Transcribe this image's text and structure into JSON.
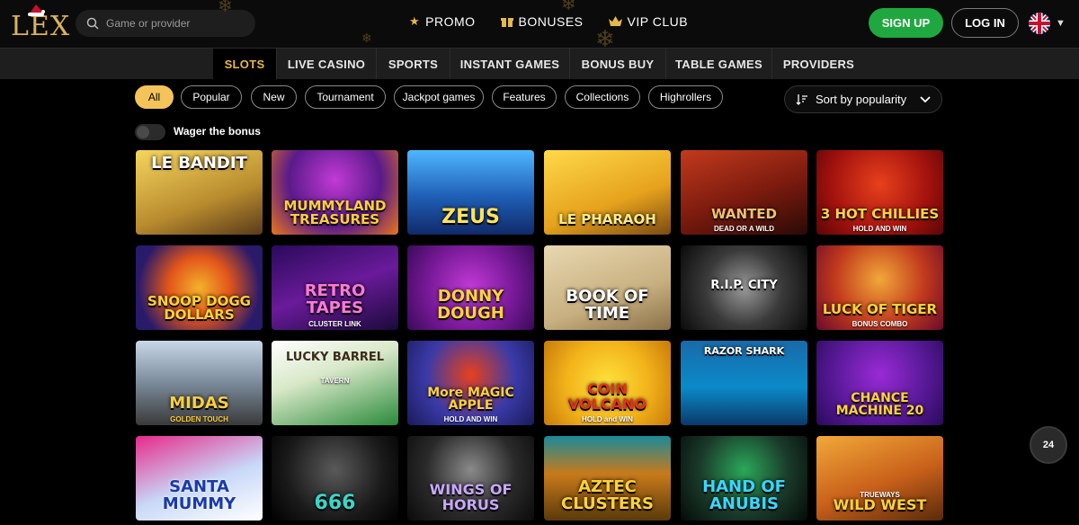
{
  "header": {
    "logo_text": "LEX",
    "search_placeholder": "Game or provider",
    "nav": [
      {
        "label": "PROMO",
        "icon": "star-icon"
      },
      {
        "label": "BONUSES",
        "icon": "gift-icon"
      },
      {
        "label": "VIP CLUB",
        "icon": "crown-icon"
      }
    ],
    "signup_label": "SIGN UP",
    "login_label": "LOG IN",
    "language_icon": "uk-flag-icon"
  },
  "categories": [
    "SLOTS",
    "LIVE CASINO",
    "SPORTS",
    "INSTANT GAMES",
    "BONUS BUY",
    "TABLE GAMES",
    "PROVIDERS"
  ],
  "active_category": "SLOTS",
  "filters": [
    "All",
    "Popular",
    "New",
    "Tournament",
    "Jackpot games",
    "Features",
    "Collections",
    "Highrollers"
  ],
  "active_filter": "All",
  "sort_label": "Sort by popularity",
  "wager_label": "Wager the bonus",
  "games": [
    {
      "title": "LE BANDIT",
      "sub": ""
    },
    {
      "title": "MUMMYLAND TREASURES",
      "sub": ""
    },
    {
      "title": "ZEUS",
      "sub": ""
    },
    {
      "title": "LE PHARAOH",
      "sub": ""
    },
    {
      "title": "WANTED",
      "sub": "DEAD OR A WILD"
    },
    {
      "title": "3 HOT CHILLIES",
      "sub": "HOLD AND WIN"
    },
    {
      "title": "SNOOP DOGG DOLLARS",
      "sub": ""
    },
    {
      "title": "RETRO TAPES",
      "sub": "CLUSTER LINK"
    },
    {
      "title": "DONNY DOUGH",
      "sub": ""
    },
    {
      "title": "BOOK OF TIME",
      "sub": ""
    },
    {
      "title": "R.I.P. CITY",
      "sub": ""
    },
    {
      "title": "LUCK OF TIGER",
      "sub": "BONUS COMBO"
    },
    {
      "title": "MIDAS",
      "sub": "GOLDEN TOUCH"
    },
    {
      "title": "LUCKY BARREL",
      "sub": "TAVERN"
    },
    {
      "title": "More MAGIC APPLE",
      "sub": "HOLD AND WIN"
    },
    {
      "title": "COIN VOLCANO",
      "sub": "HOLD and WIN"
    },
    {
      "title": "RAZOR SHARK",
      "sub": ""
    },
    {
      "title": "CHANCE MACHINE 20",
      "sub": ""
    },
    {
      "title": "SANTA MUMMY",
      "sub": ""
    },
    {
      "title": "666",
      "sub": ""
    },
    {
      "title": "WINGS OF HORUS",
      "sub": ""
    },
    {
      "title": "AZTEC CLUSTERS",
      "sub": ""
    },
    {
      "title": "HAND OF ANUBIS",
      "sub": ""
    },
    {
      "title": "WILD WEST",
      "sub": "TRUEWAYS"
    }
  ],
  "support_label": "24",
  "colors": {
    "accent": "#f4c45a",
    "signup": "#1fa83f",
    "active_tab": "#e3b94a"
  }
}
